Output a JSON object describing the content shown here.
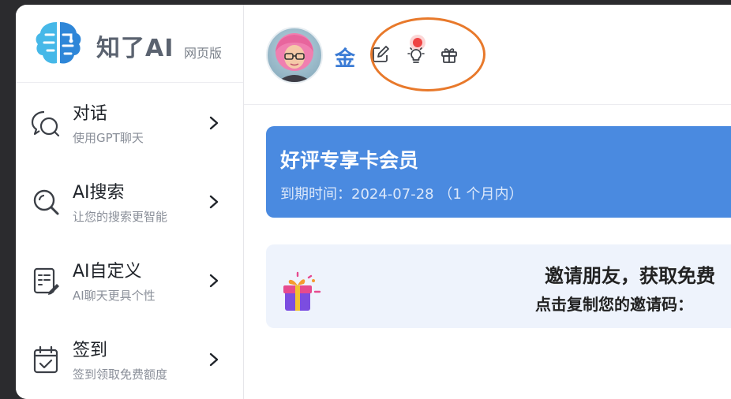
{
  "brand": {
    "name": "知了AI",
    "tag": "网页版"
  },
  "sidebar": {
    "items": [
      {
        "title": "对话",
        "subtitle": "使用GPT聊天",
        "icon": "chat-bubbles-icon"
      },
      {
        "title": "AI搜索",
        "subtitle": "让您的搜索更智能",
        "icon": "search-icon"
      },
      {
        "title": "AI自定义",
        "subtitle": "AI聊天更具个性",
        "icon": "edit-document-icon"
      },
      {
        "title": "签到",
        "subtitle": "签到领取免费额度",
        "icon": "calendar-check-icon"
      }
    ]
  },
  "header": {
    "user_name": "金",
    "icons": [
      "edit-icon",
      "lightbulb-icon",
      "gift-icon"
    ],
    "accent": "#3a7bd5",
    "highlight_color": "#e8792b"
  },
  "membership": {
    "title": "好评专享卡会员",
    "expiry": "到期时间：2024-07-28 （1 个月内）",
    "color": "#4a8ae0"
  },
  "invite": {
    "title": "邀请朋友，获取免费",
    "subtitle": "点击复制您的邀请码：",
    "icon": "gift-box-icon"
  }
}
